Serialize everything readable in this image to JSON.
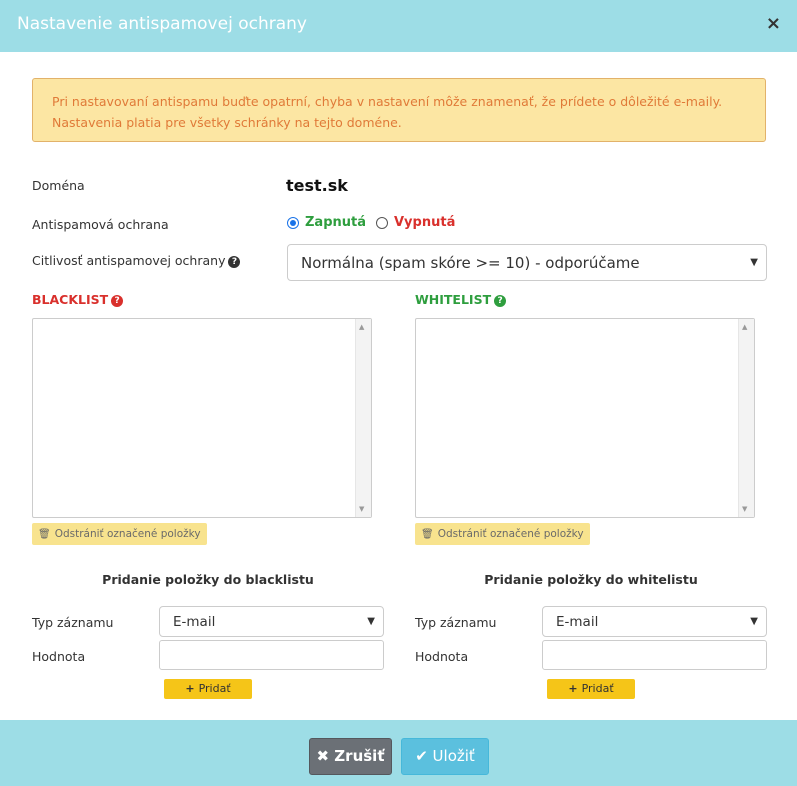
{
  "modal": {
    "title": "Nastavenie antispamovej ochrany",
    "close_icon": "×"
  },
  "alert": {
    "line1": "Pri nastavovaní antispamu buďte opatrní, chyba v nastavení môže znamenať, že prídete o dôležité e-maily.",
    "line2": "Nastavenia platia pre všetky schránky na tejto doméne."
  },
  "form": {
    "domain_label": "Doména",
    "domain_value": "test.sk",
    "antispam_label": "Antispamová ochrana",
    "option_on": "Zapnutá",
    "option_off": "Vypnutá",
    "selected_option": "Zapnutá",
    "sensitivity_label": "Citlivosť antispamovej ochrany",
    "sensitivity_value": "Normálna (spam skóre >= 10) - odporúčame"
  },
  "blacklist": {
    "title": "BLACKLIST",
    "remove_label": "Odstrániť označené položky",
    "add_title": "Pridanie položky do blacklistu",
    "type_label": "Typ záznamu",
    "type_value": "E-mail",
    "value_label": "Hodnota",
    "value": "",
    "add_label": "Pridať"
  },
  "whitelist": {
    "title": "WHITELIST",
    "remove_label": "Odstrániť označené položky",
    "add_title": "Pridanie položky do whitelistu",
    "type_label": "Typ záznamu",
    "type_value": "E-mail",
    "value_label": "Hodnota",
    "value": "",
    "add_label": "Pridať"
  },
  "footer": {
    "cancel_label": "Zrušiť",
    "save_label": "Uložiť"
  },
  "colors": {
    "header_bg": "#9ddde6",
    "blacklist": "#d9302c",
    "whitelist": "#2e9e3e",
    "alert_text": "#e07a38"
  }
}
